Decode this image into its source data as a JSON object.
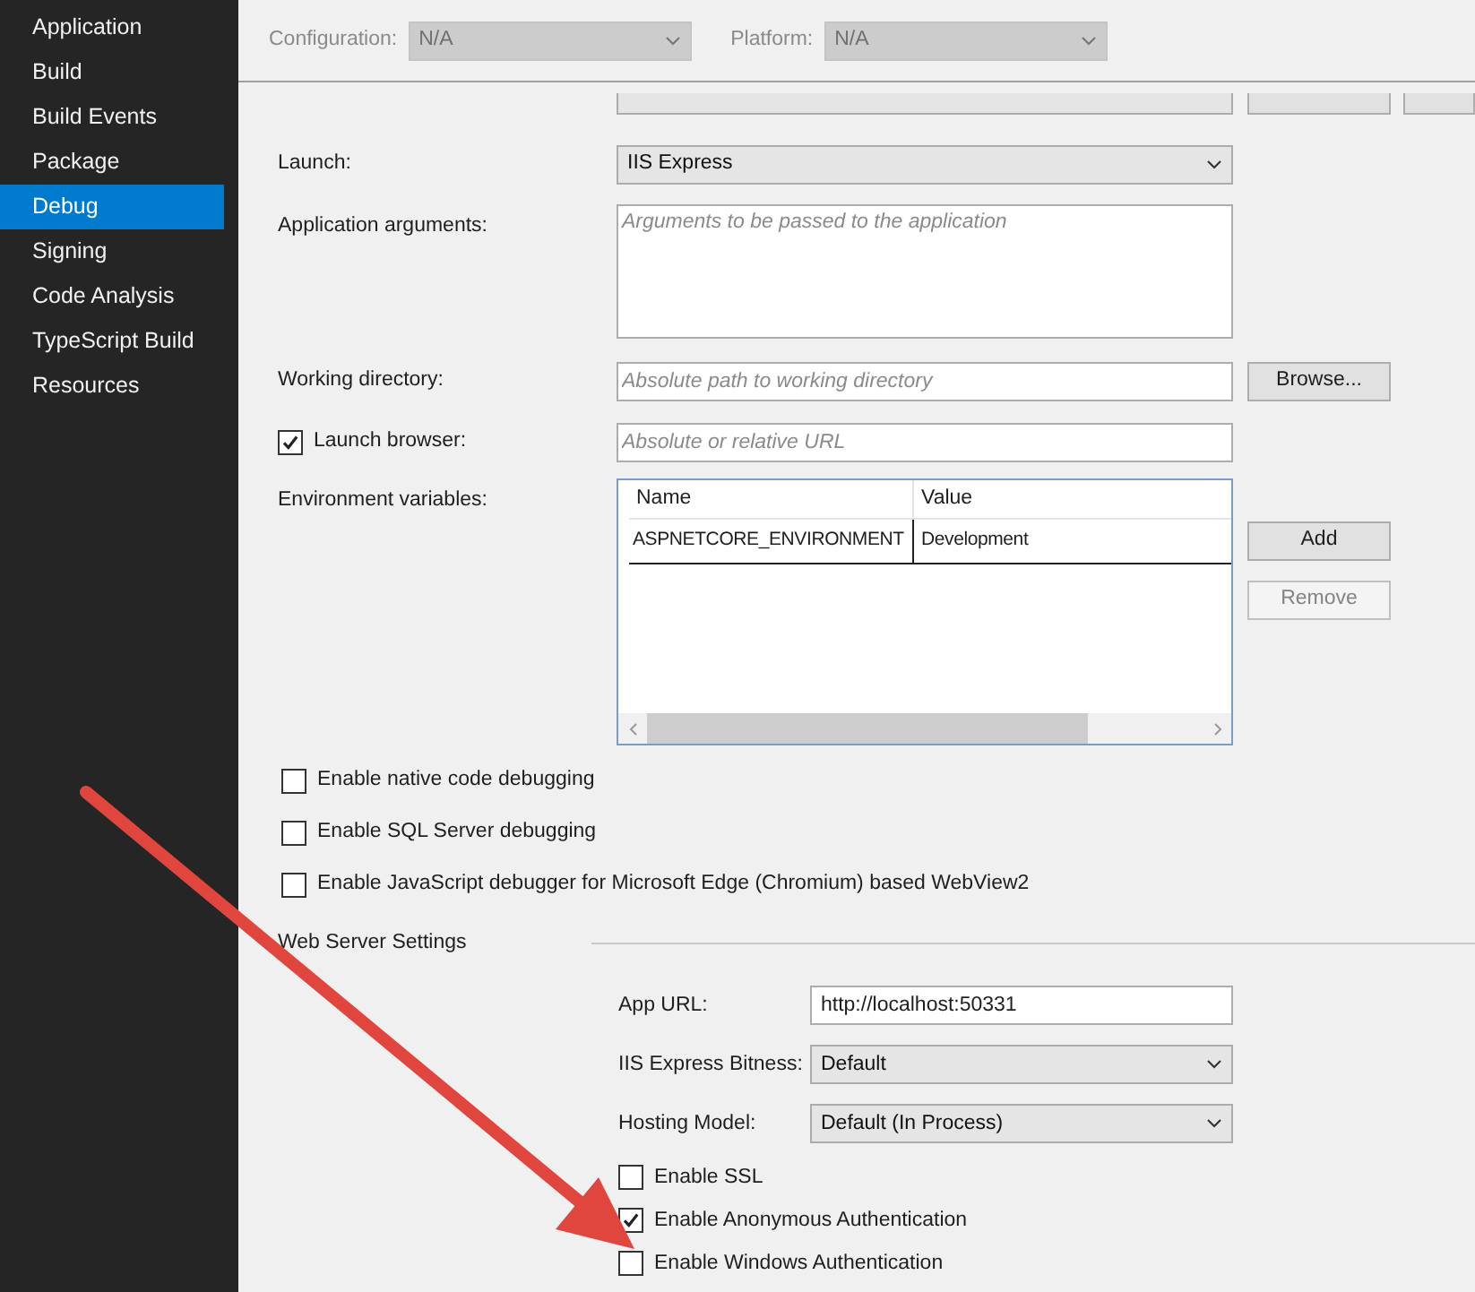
{
  "sidebar": {
    "items": [
      {
        "label": "Application",
        "selected": false
      },
      {
        "label": "Build",
        "selected": false
      },
      {
        "label": "Build Events",
        "selected": false
      },
      {
        "label": "Package",
        "selected": false
      },
      {
        "label": "Debug",
        "selected": true
      },
      {
        "label": "Signing",
        "selected": false
      },
      {
        "label": "Code Analysis",
        "selected": false
      },
      {
        "label": "TypeScript Build",
        "selected": false
      },
      {
        "label": "Resources",
        "selected": false
      }
    ]
  },
  "toolbar": {
    "configuration": {
      "label": "Configuration:",
      "value": "N/A",
      "disabled": true
    },
    "platform": {
      "label": "Platform:",
      "value": "N/A",
      "disabled": true
    }
  },
  "launch": {
    "label": "Launch:",
    "value": "IIS Express"
  },
  "application_arguments": {
    "label": "Application arguments:",
    "placeholder": "Arguments to be passed to the application"
  },
  "working_directory": {
    "label": "Working directory:",
    "placeholder": "Absolute path to working directory",
    "button": "Browse..."
  },
  "launch_browser": {
    "label": "Launch browser:",
    "checked": true,
    "placeholder": "Absolute or relative URL"
  },
  "environment_variables": {
    "label": "Environment variables:",
    "columns": [
      "Name",
      "Value"
    ],
    "rows": [
      [
        "ASPNETCORE_ENVIRONMENT",
        "Development"
      ]
    ],
    "buttons": [
      {
        "label": "Add",
        "disabled": false
      },
      {
        "label": "Remove",
        "disabled": true
      }
    ]
  },
  "debug_options": [
    {
      "label": "Enable native code debugging",
      "checked": false
    },
    {
      "label": "Enable SQL Server debugging",
      "checked": false
    },
    {
      "label": "Enable JavaScript debugger for Microsoft Edge (Chromium) based WebView2",
      "checked": false
    }
  ],
  "web_server_settings": {
    "title": "Web Server Settings",
    "fields": [
      {
        "kind": "text",
        "label": "App URL:",
        "value": "http://localhost:50331"
      },
      {
        "kind": "dropdown",
        "label": "IIS Express Bitness:",
        "value": "Default"
      },
      {
        "kind": "dropdown",
        "label": "Hosting Model:",
        "value": "Default (In Process)"
      }
    ],
    "options": [
      {
        "label": "Enable SSL",
        "checked": false
      },
      {
        "label": "Enable Anonymous Authentication",
        "checked": true
      },
      {
        "label": "Enable Windows Authentication",
        "checked": false
      }
    ]
  }
}
